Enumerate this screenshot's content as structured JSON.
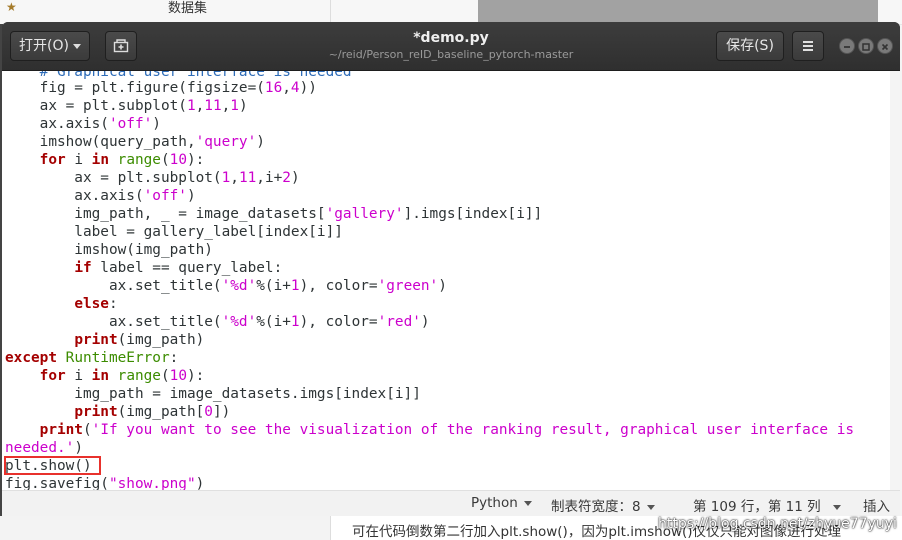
{
  "background": {
    "top_text": "数据集",
    "bottom_text": "可在代码倒数第二行加入plt.show()，因为plt.imshow()仅仅只能对图像进行处理",
    "watermark": "https://blog.csdn.net/zhyue77yuyi"
  },
  "window": {
    "title": "*demo.py",
    "subtitle": "~/reid/Person_reID_baseline_pytorch-master",
    "open_label": "打开(O)",
    "save_label": "保存(S)"
  },
  "code_lines": [
    "    # Graphical user interface is needed",
    "    fig = plt.figure(figsize=(16,4))",
    "    ax = plt.subplot(1,11,1)",
    "    ax.axis('off')",
    "    imshow(query_path,'query')",
    "    for i in range(10):",
    "        ax = plt.subplot(1,11,i+2)",
    "        ax.axis('off')",
    "        img_path, _ = image_datasets['gallery'].imgs[index[i]]",
    "        label = gallery_label[index[i]]",
    "        imshow(img_path)",
    "        if label == query_label:",
    "            ax.set_title('%d'%(i+1), color='green')",
    "        else:",
    "            ax.set_title('%d'%(i+1), color='red')",
    "        print(img_path)",
    "except RuntimeError:",
    "    for i in range(10):",
    "        img_path = image_datasets.imgs[index[i]]",
    "        print(img_path[0])",
    "    print('If you want to see the visualization of the ranking result, graphical user interface is",
    "needed.')",
    "plt.show()",
    "fig.savefig(\"show.png\")"
  ],
  "highlighted_line": "plt.show()",
  "statusbar": {
    "language": "Python",
    "tab_width": "制表符宽度：8",
    "position": "第 109 行，第 11 列",
    "mode": "插入"
  },
  "colors": {
    "keyword": "#a40000",
    "string": "#cc00cc",
    "builtin_class": "#3c8c00",
    "highlight_box": "#e8312c"
  }
}
